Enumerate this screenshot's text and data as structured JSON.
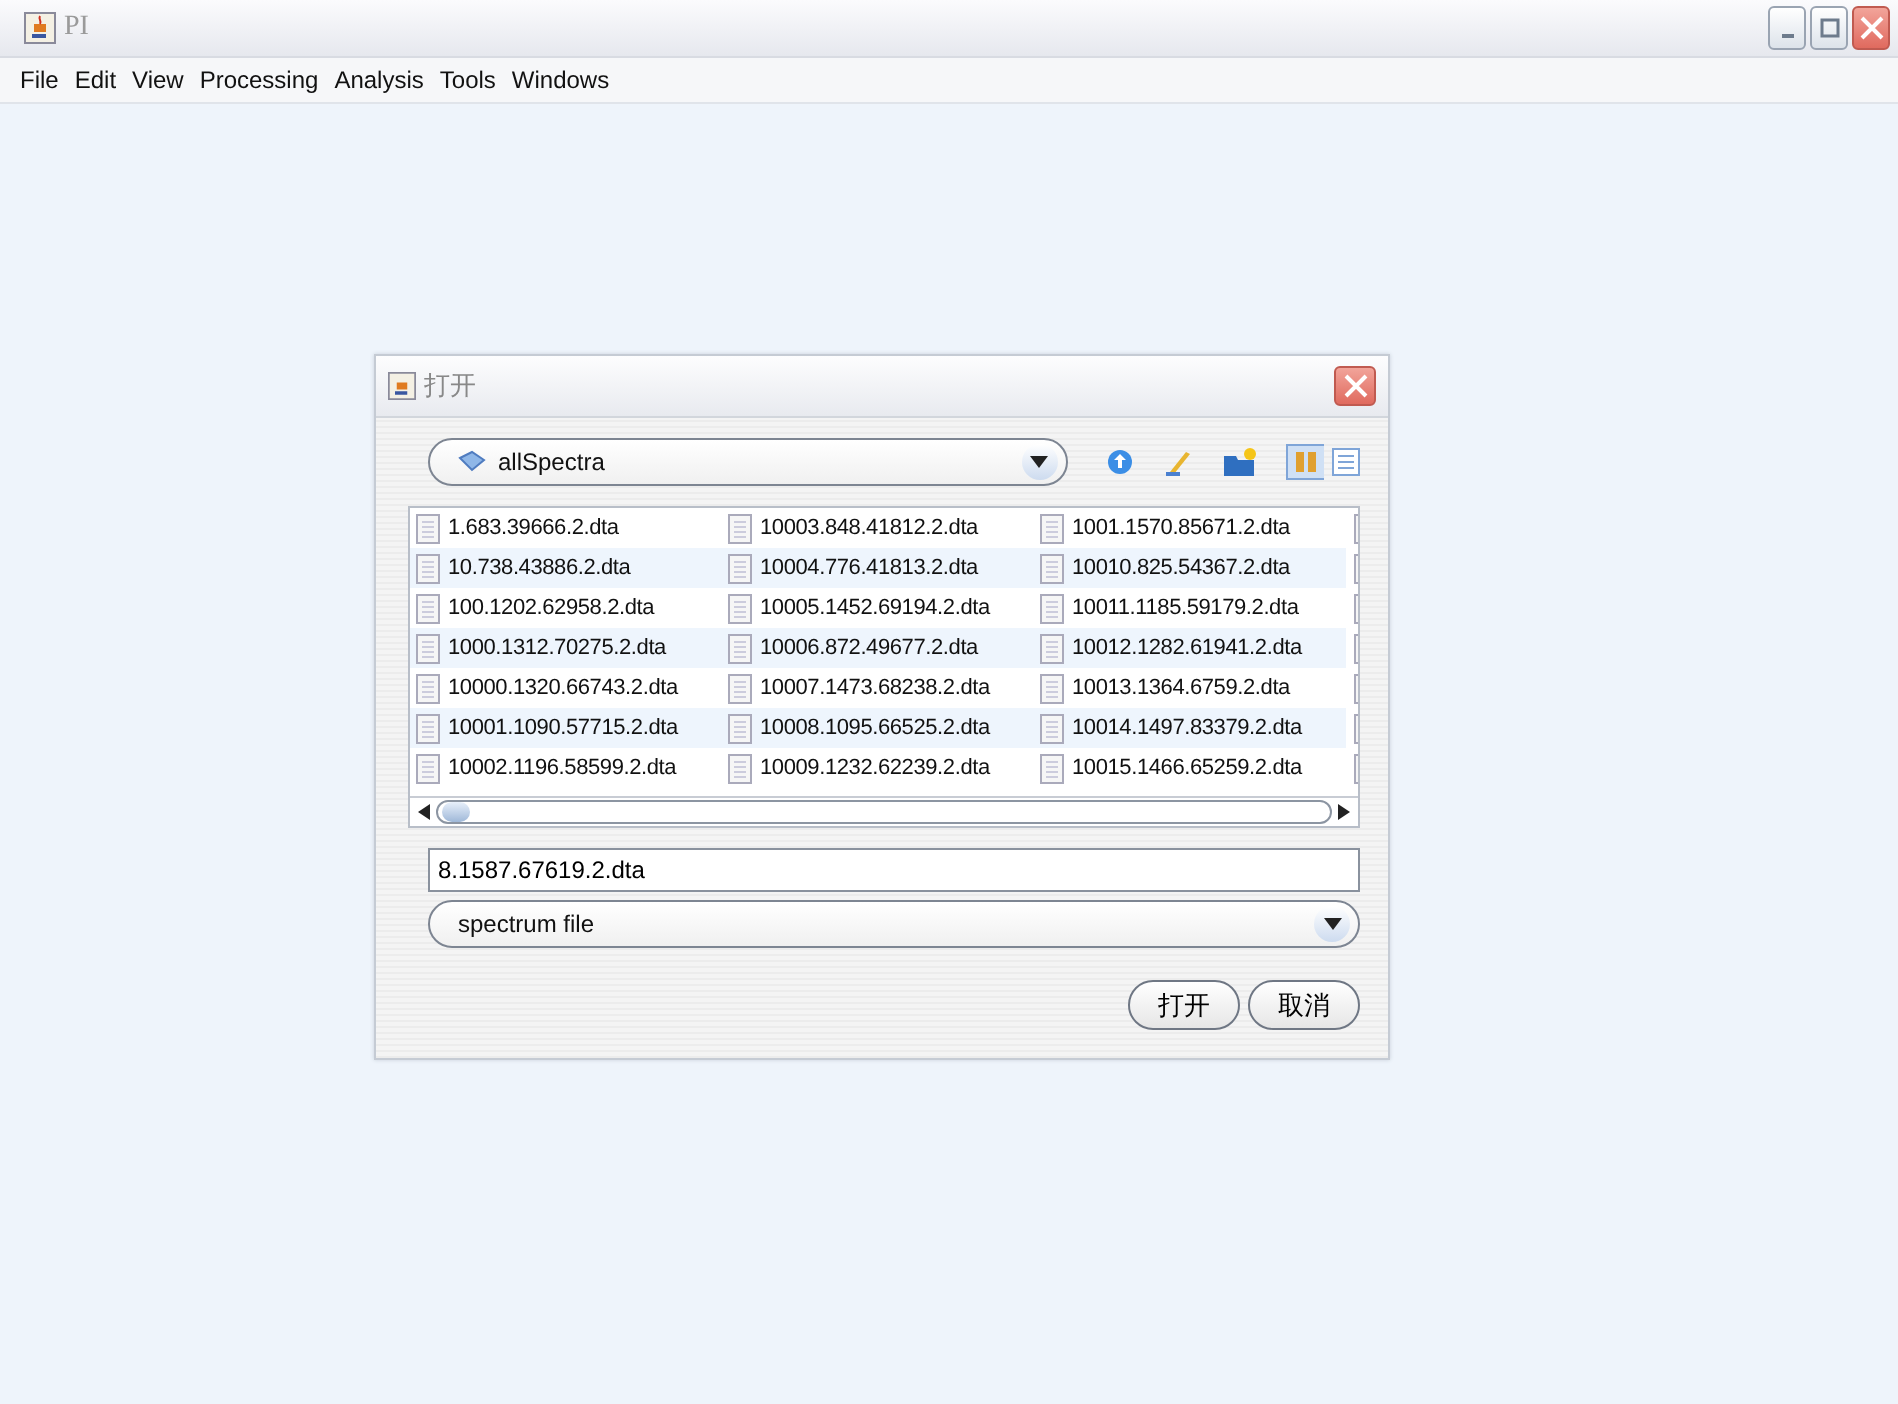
{
  "window": {
    "title": "PI"
  },
  "menu": [
    "File",
    "Edit",
    "View",
    "Processing",
    "Analysis",
    "Tools",
    "Windows"
  ],
  "dialog": {
    "title": "打开",
    "look_in": "allSpectra",
    "files": [
      [
        "1.683.39666.2.dta",
        "10.738.43886.2.dta",
        "100.1202.62958.2.dta",
        "1000.1312.70275.2.dta",
        "10000.1320.66743.2.dta",
        "10001.1090.57715.2.dta",
        "10002.1196.58599.2.dta"
      ],
      [
        "10003.848.41812.2.dta",
        "10004.776.41813.2.dta",
        "10005.1452.69194.2.dta",
        "10006.872.49677.2.dta",
        "10007.1473.68238.2.dta",
        "10008.1095.66525.2.dta",
        "10009.1232.62239.2.dta"
      ],
      [
        "1001.1570.85671.2.dta",
        "10010.825.54367.2.dta",
        "10011.1185.59179.2.dta",
        "10012.1282.61941.2.dta",
        "10013.1364.6759.2.dta",
        "10014.1497.83379.2.dta",
        "10015.1466.65259.2.dta"
      ]
    ],
    "file_name": "8.1587.67619.2.dta",
    "file_type": "spectrum file",
    "buttons": [
      "打开",
      "取消"
    ]
  }
}
